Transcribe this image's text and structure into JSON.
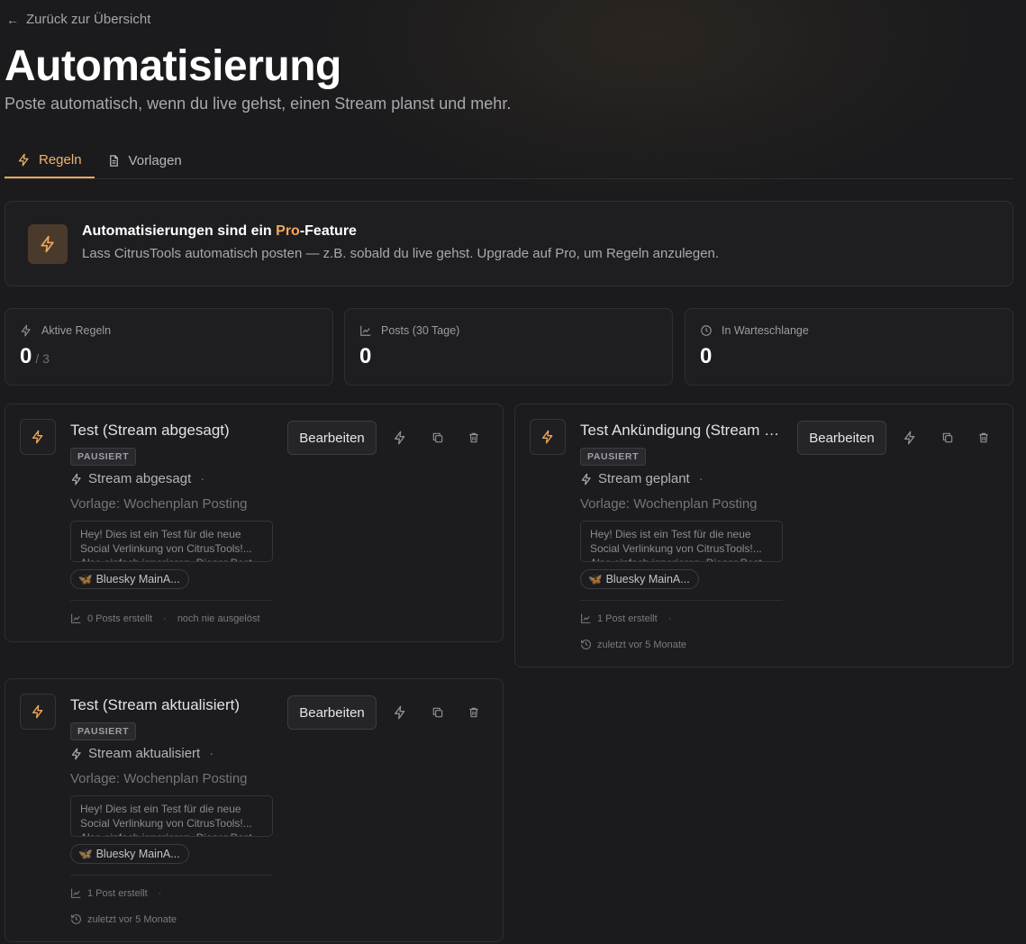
{
  "header": {
    "back_label": "Zurück zur Übersicht",
    "title": "Automatisierung",
    "subtitle": "Poste automatisch, wenn du live gehst, einen Stream planst und mehr."
  },
  "tabs": [
    {
      "label": "Regeln",
      "icon": "bolt-icon",
      "active": true
    },
    {
      "label": "Vorlagen",
      "icon": "document-icon",
      "active": false
    }
  ],
  "pro_notice": {
    "title_before": "Automatisierungen sind ein ",
    "title_highlight": "Pro",
    "title_after": "-Feature",
    "text": "Lass CitrusTools automatisch posten — z.B. sobald du live gehst. Upgrade auf Pro, um Regeln anzulegen."
  },
  "stats": [
    {
      "label": "Aktive Regeln",
      "icon": "bolt-icon",
      "value": "0",
      "max": "/ 3"
    },
    {
      "label": "Posts (30 Tage)",
      "icon": "chart-icon",
      "value": "0"
    },
    {
      "label": "In Warteschlange",
      "icon": "clock-icon",
      "value": "0"
    }
  ],
  "rules": [
    {
      "name": "Test (Stream abgesagt)",
      "status": "PAUSIERT",
      "trigger": "Stream abgesagt",
      "template": "Vorlage: Wochenplan Posting",
      "preview": "Hey! Dies ist ein Test für die neue Social Verlinkung von CitrusTools!... Also einfach ignorieren. Dieser Post",
      "account": "Bluesky MainA...",
      "posts": "0 Posts erstellt",
      "last": "noch nie ausgelöst",
      "edit_label": "Bearbeiten"
    },
    {
      "name": "Test Ankündigung (Stream geplant)",
      "status": "PAUSIERT",
      "trigger": "Stream geplant",
      "template": "Vorlage: Wochenplan Posting",
      "preview": "Hey! Dies ist ein Test für die neue Social Verlinkung von CitrusTools!... Also einfach ignorieren. Dieser Post",
      "account": "Bluesky MainA...",
      "posts": "1 Post erstellt",
      "last": "zuletzt vor 5 Monate",
      "edit_label": "Bearbeiten"
    },
    {
      "name": "Test (Stream aktualisiert)",
      "status": "PAUSIERT",
      "trigger": "Stream aktualisiert",
      "template": "Vorlage: Wochenplan Posting",
      "preview": "Hey! Dies ist ein Test für die neue Social Verlinkung von CitrusTools!... Also einfach ignorieren. Dieser Post",
      "account": "Bluesky MainA...",
      "posts": "1 Post erstellt",
      "last": "zuletzt vor 5 Monate",
      "edit_label": "Bearbeiten"
    }
  ],
  "colors": {
    "accent": "#f0a85a",
    "background": "#1b1b1d",
    "card": "#1c1c1f"
  }
}
